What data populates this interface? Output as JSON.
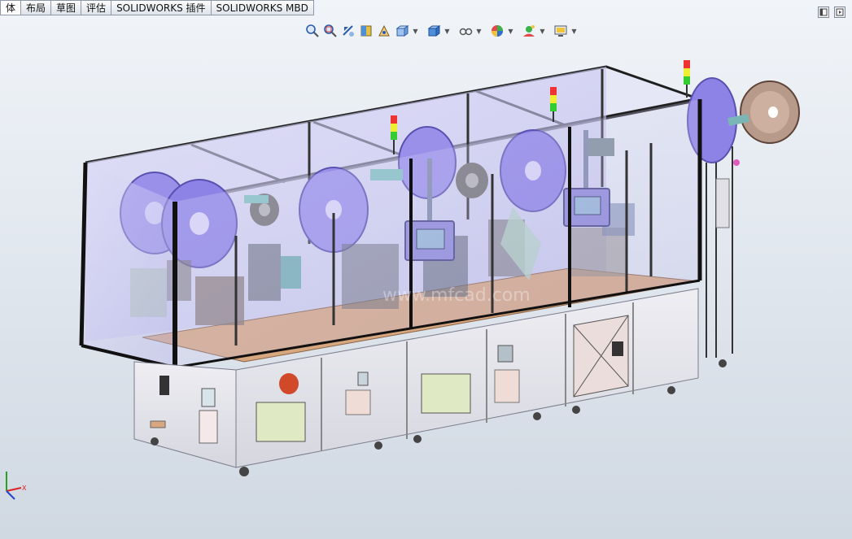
{
  "tabs": [
    {
      "label": "体",
      "active": true
    },
    {
      "label": "布局",
      "active": false
    },
    {
      "label": "草图",
      "active": false
    },
    {
      "label": "评估",
      "active": false
    },
    {
      "label": "SOLIDWORKS 插件",
      "active": false
    },
    {
      "label": "SOLIDWORKS MBD",
      "active": false
    }
  ],
  "view_toolbar": [
    "zoom-to-fit-icon",
    "zoom-to-area-icon",
    "previous-view-icon",
    "section-view-icon",
    "dynamic-annotation-icon",
    "view-orientation-icon",
    "display-style-icon",
    "hide-show-items-icon",
    "edit-appearance-icon",
    "apply-scene-icon",
    "view-settings-icon"
  ],
  "watermark": "www.mfcad.com",
  "colors": {
    "frame": "#1a1a1a",
    "glass": "#c9c8f0",
    "reel": "#8a7fe6",
    "deck": "#d7a77f",
    "cabinet": "#e4e4ec",
    "panel_teal": "#c9dfe0"
  }
}
